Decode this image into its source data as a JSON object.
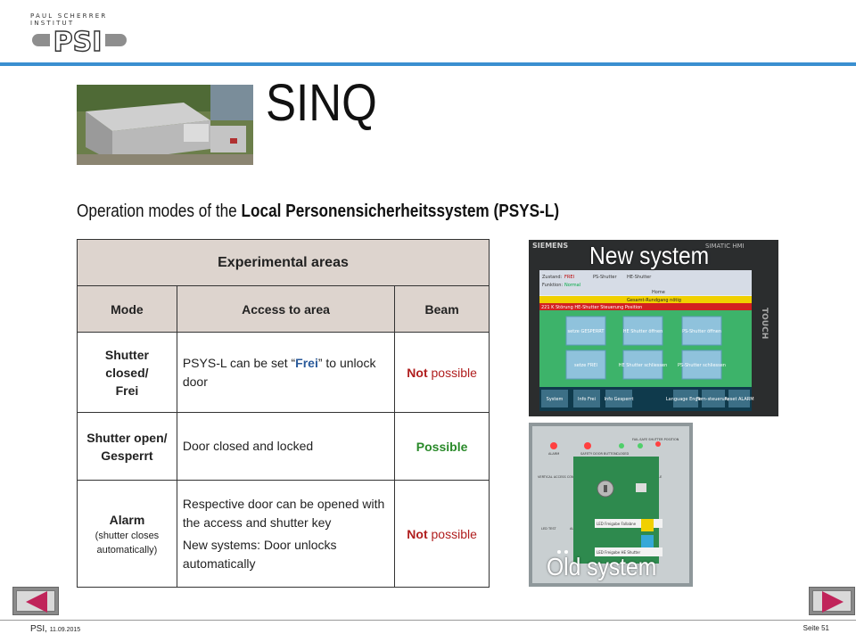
{
  "header": {
    "institute": "PAUL SCHERRER INSTITUT",
    "logo_text": "PSI"
  },
  "title": "SINQ",
  "subtitle": {
    "prefix": "Operation modes of the ",
    "bold": "Local Personensicherheitssystem (PSYS-L)"
  },
  "table": {
    "heading": "Experimental  areas",
    "columns": [
      "Mode",
      "Access to area",
      "Beam"
    ],
    "rows": [
      {
        "mode_lines": [
          "Shutter",
          "closed/",
          "Frei"
        ],
        "access_pre": "PSYS-L can be set “",
        "access_em": "Frei",
        "access_post": "” to unlock door",
        "beam_bold": "Not",
        "beam_rest": " possible"
      },
      {
        "mode_lines": [
          "Shutter open/",
          "Gesperrt"
        ],
        "access": "Door closed and locked",
        "beam": "Possible"
      },
      {
        "mode": "Alarm",
        "mode_note": "(shutter closes automatically)",
        "access_1": "Respective door can be opened with the access and shutter key",
        "access_2": "New systems: Door unlocks automatically",
        "beam_bold": "Not",
        "beam_rest": " possible"
      }
    ]
  },
  "images": {
    "new_label": "New system",
    "old_label": "Old system",
    "hmi": {
      "brand": "SIEMENS",
      "product": "SIMATIC HMI",
      "touch": "TOUCH",
      "zustand_label": "Zustand:",
      "zustand_value": "FREI",
      "funktion_label": "Funktion:",
      "funktion_value": "Normal",
      "ps_shutter": "PS-Shutter",
      "he_shutter": "HE-Shutter",
      "home": "Home",
      "rundgang": "Gesamt-Rundgang nötig",
      "status_line": "221  K  Störung    HE-Shutter Steuerung Position",
      "buttons": [
        "setze GESPERRT",
        "HE Shutter öffnen",
        "PS-Shutter öffnen",
        "setze FREI",
        "HE Shutter schliessen",
        "PS-Shutter schliessen"
      ],
      "bottom": [
        "System",
        "Info Frei",
        "Info Gesperrt",
        "Language English",
        "Fern-steuerung",
        "Reset ALARM"
      ]
    },
    "old": {
      "labels": [
        "ALARM",
        "SAFETY DOOR BUTTON",
        "CLOSED",
        "FAIL-SAFE SHUTTER POSITION",
        "VERTICAL ACCESS CONTROL",
        "KEY FREE",
        "MAIN SHUTTER ENABLE",
        "LED TEST",
        "ALARM RESET",
        "LED Freigabe Fallabne",
        "LED Freigabe HE Shutter"
      ]
    }
  },
  "footer": {
    "org": "PSI,",
    "date": "11.09.2015",
    "page": "Seite 51"
  },
  "colors": {
    "header_rule": "#3a8fd0",
    "table_header_bg": "#ddd4ce",
    "not_possible": "#b01e1e",
    "possible": "#2a8a2a"
  }
}
